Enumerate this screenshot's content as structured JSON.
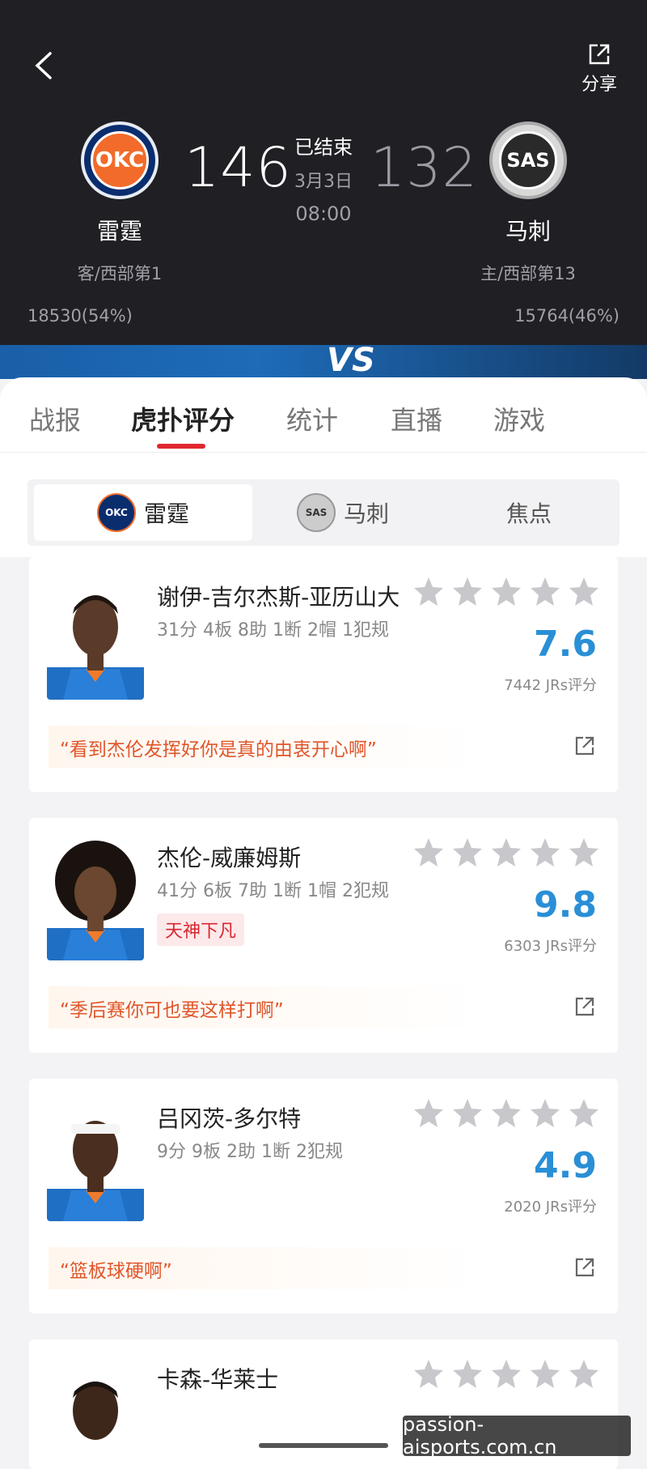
{
  "header": {
    "share_label": "分享",
    "status": "已结束",
    "date": "3月3日",
    "time": "08:00",
    "vs_text": "VS"
  },
  "away_team": {
    "name": "雷霆",
    "logo_text": "OKC",
    "score": "146",
    "sub": "客/西部第1",
    "support": "18530(54%)"
  },
  "home_team": {
    "name": "马刺",
    "logo_text": "SAS",
    "score": "132",
    "sub": "主/西部第13",
    "support": "15764(46%)"
  },
  "tabs": [
    "战报",
    "虎扑评分",
    "统计",
    "直播",
    "游戏"
  ],
  "segments": {
    "okc": "雷霆",
    "sas": "马刺",
    "focus": "焦点"
  },
  "players": [
    {
      "name": "谢伊-吉尔杰斯-亚历山大",
      "stats": "31分 4板 8助 1断 2帽 1犯规",
      "rating": "7.6",
      "votes": "7442 JRs评分",
      "tag": "",
      "quote": "“看到杰伦发挥好你是真的由衷开心啊”"
    },
    {
      "name": "杰伦-威廉姆斯",
      "stats": "41分 6板 7助 1断 1帽 2犯规",
      "rating": "9.8",
      "votes": "6303 JRs评分",
      "tag": "天神下凡",
      "quote": "“季后赛你可也要这样打啊”"
    },
    {
      "name": "吕冈茨-多尔特",
      "stats": "9分 9板 2助 1断 2犯规",
      "rating": "4.9",
      "votes": "2020 JRs评分",
      "tag": "",
      "quote": "“篮板球硬啊”"
    },
    {
      "name": "卡森-华莱士"
    }
  ],
  "watermark": "passion-aisports.com.cn",
  "colors": {
    "accent_red": "#e0272f",
    "rating_blue": "#2a8fd6",
    "quote_orange": "#e0562a",
    "header_bg": "#1f1f24"
  }
}
